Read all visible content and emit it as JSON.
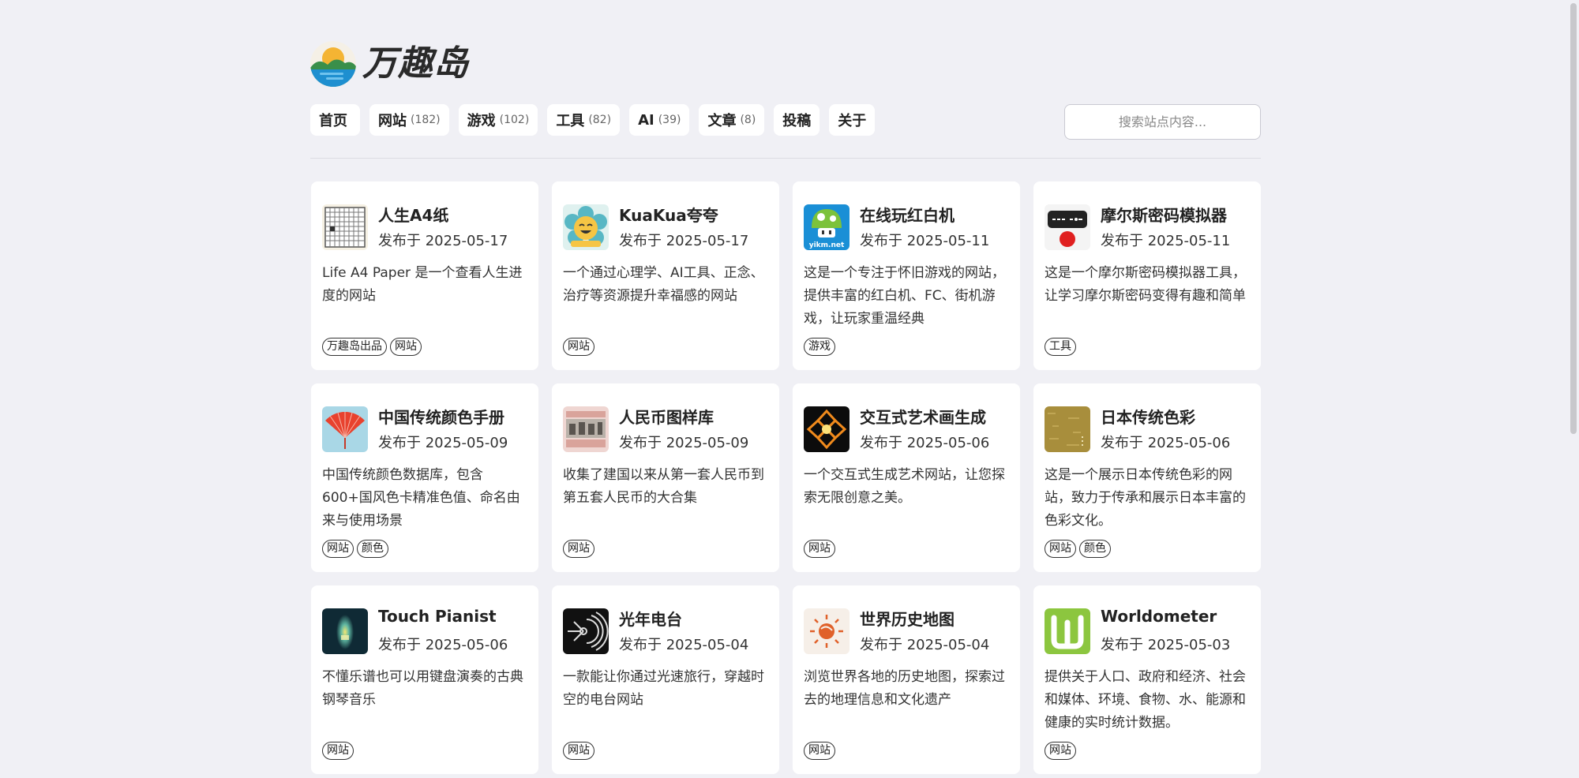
{
  "site": {
    "name": "万趣岛"
  },
  "nav": [
    {
      "label": "首页",
      "count": ""
    },
    {
      "label": "网站",
      "count": "(182)"
    },
    {
      "label": "游戏",
      "count": "(102)"
    },
    {
      "label": "工具",
      "count": "(82)"
    },
    {
      "label": "AI",
      "count": "(39)"
    },
    {
      "label": "文章",
      "count": "(8)"
    },
    {
      "label": "投稿",
      "count": ""
    },
    {
      "label": "关于",
      "count": ""
    }
  ],
  "search": {
    "placeholder": "搜索站点内容..."
  },
  "cards": [
    {
      "title": "人生A4纸",
      "date": "发布于 2025-05-17",
      "desc": "Life A4 Paper 是一个查看人生进度的网站",
      "tags": [
        "万趣岛出品",
        "网站"
      ],
      "icon": "grid-paper-icon"
    },
    {
      "title": "KuaKua夸夸",
      "date": "发布于 2025-05-17",
      "desc": "一个通过心理学、AI工具、正念、治疗等资源提升幸福感的网站",
      "tags": [
        "网站"
      ],
      "icon": "smiley-flower-icon"
    },
    {
      "title": "在线玩红白机",
      "date": "发布于 2025-05-11",
      "desc": "这是一个专注于怀旧游戏的网站，提供丰富的红白机、FC、街机游戏，让玩家重温经典",
      "tags": [
        "游戏"
      ],
      "icon": "mushroom-icon",
      "icon_text": "yikm.net"
    },
    {
      "title": "摩尔斯密码模拟器",
      "date": "发布于 2025-05-11",
      "desc": "这是一个摩尔斯密码模拟器工具，让学习摩尔斯密码变得有趣和简单",
      "tags": [
        "工具"
      ],
      "icon": "morse-key-icon"
    },
    {
      "title": "中国传统颜色手册",
      "date": "发布于 2025-05-09",
      "desc": "中国传统颜色数据库，包含600+国风色卡精准色值、命名由来与使用场景",
      "tags": [
        "网站",
        "颜色"
      ],
      "icon": "fan-icon"
    },
    {
      "title": "人民币图样库",
      "date": "发布于 2025-05-09",
      "desc": "收集了建国以来从第一套人民币到第五套人民币的大合集",
      "tags": [
        "网站"
      ],
      "icon": "banknote-icon"
    },
    {
      "title": "交互式艺术画生成",
      "date": "发布于 2025-05-06",
      "desc": "一个交互式生成艺术网站，让您探索无限创意之美。",
      "tags": [
        "网站"
      ],
      "icon": "kaleidoscope-icon"
    },
    {
      "title": "日本传统色彩",
      "date": "发布于 2025-05-06",
      "desc": "这是一个展示日本传统色彩的网站，致力于传承和展示日本丰富的色彩文化。",
      "tags": [
        "网站",
        "颜色"
      ],
      "icon": "gold-texture-icon"
    },
    {
      "title": "Touch Pianist",
      "date": "发布于 2025-05-06",
      "desc": "不懂乐谱也可以用键盘演奏的古典钢琴音乐",
      "tags": [
        "网站"
      ],
      "icon": "glow-icon"
    },
    {
      "title": "光年电台",
      "date": "发布于 2025-05-04",
      "desc": "一款能让你通过光速旅行，穿越时空的电台网站",
      "tags": [
        "网站"
      ],
      "icon": "radio-wave-icon"
    },
    {
      "title": "世界历史地图",
      "date": "发布于 2025-05-04",
      "desc": "浏览世界各地的历史地图，探索过去的地理信息和文化遗产",
      "tags": [
        "网站"
      ],
      "icon": "sun-map-icon"
    },
    {
      "title": "Worldometer",
      "date": "发布于 2025-05-03",
      "desc": "提供关于人口、政府和经济、社会和媒体、环境、食物、水、能源和健康的实时统计数据。",
      "tags": [
        "网站"
      ],
      "icon": "w-letter-icon"
    }
  ],
  "colors": {
    "background": "#f0f0f5",
    "card": "#ffffff",
    "worldometer_green": "#8cc63f"
  }
}
